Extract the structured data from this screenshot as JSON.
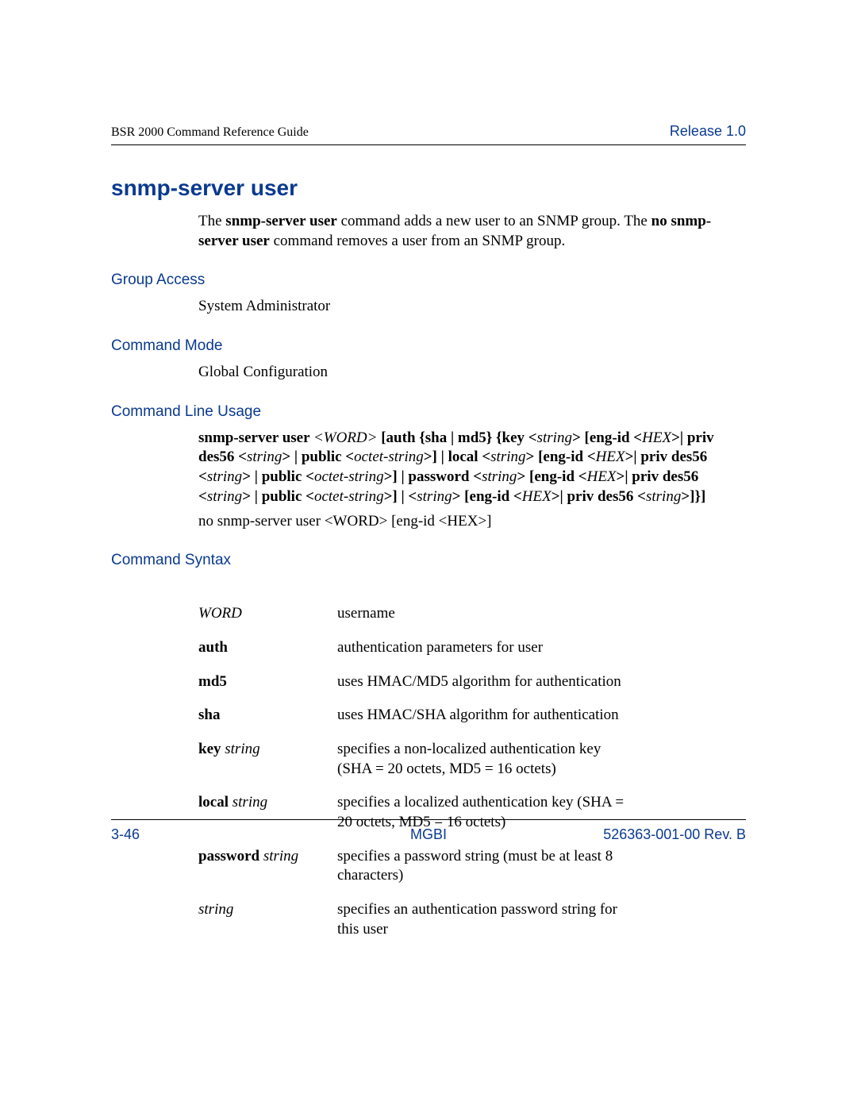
{
  "header": {
    "left": "BSR 2000 Command Reference Guide",
    "right": "Release 1.0"
  },
  "title": "snmp-server user",
  "intro": {
    "pre": "The ",
    "bold1": "snmp-server user",
    "mid1": " command adds a new user to an SNMP group. The ",
    "bold2": "no snmp-server user",
    "post": " command removes a user from an SNMP group."
  },
  "sections": {
    "group_access": {
      "heading": "Group Access",
      "body": "System Administrator"
    },
    "command_mode": {
      "heading": "Command Mode",
      "body": "Global Configuration"
    },
    "cli_usage": {
      "heading": "Command Line Usage"
    },
    "command_syntax": {
      "heading": "Command Syntax"
    }
  },
  "usage": {
    "p1": "snmp-server user ",
    "p2": "<WORD>",
    "p3": " [auth {sha | md5} {key <",
    "p4": "string",
    "p5": "> [eng-id <",
    "p6": "HEX",
    "p7": ">| priv des56 <",
    "p8": "string",
    "p9": "> | public <",
    "p10": "octet-string",
    "p11": ">] | local <",
    "p12": "string",
    "p13": "> [eng-id <",
    "p14": "HEX",
    "p15": ">| priv des56 <",
    "p16": "string",
    "p17": "> | public <",
    "p18": "octet-string",
    "p19": ">] | password <",
    "p20": "string",
    "p21": "> [eng-id <",
    "p22": "HEX",
    "p23": ">| priv des56 <",
    "p24": "string",
    "p25": "> | public <",
    "p26": "octet-string",
    "p27": ">] | <",
    "p28": "string",
    "p29": "> [eng-id <",
    "p30": "HEX",
    "p31": ">| priv des56 <",
    "p32": "string",
    "p33": ">]}]"
  },
  "usage_no": {
    "p1": "no snmp-server user ",
    "p2": "<WORD>",
    "p3": " [eng-id <",
    "p4": "HEX",
    "p5": ">]"
  },
  "syntax": [
    {
      "term_italic": "WORD",
      "term_bold": "",
      "desc": "username"
    },
    {
      "term_bold": "auth",
      "term_italic": "",
      "desc": "authentication parameters for user"
    },
    {
      "term_bold": "md5",
      "term_italic": "",
      "desc": "uses HMAC/MD5 algorithm for authentication"
    },
    {
      "term_bold": "sha",
      "term_italic": "",
      "desc": "uses HMAC/SHA algorithm for authentication"
    },
    {
      "term_bold": "key ",
      "term_italic": "string",
      "desc": "specifies a non-localized authentication key (SHA = 20 octets, MD5 = 16 octets)"
    },
    {
      "term_bold": "local ",
      "term_italic": "string",
      "desc": "specifies a localized authentication key (SHA = 20 octets, MD5 = 16 octets)"
    },
    {
      "term_bold": "password ",
      "term_italic": "string",
      "desc": "specifies a password string (must be at least 8 characters)"
    },
    {
      "term_bold": "",
      "term_italic": "string",
      "desc": "specifies an authentication password string for this user"
    }
  ],
  "footer": {
    "left": "3-46",
    "center": "MGBI",
    "right": "526363-001-00 Rev. B"
  }
}
